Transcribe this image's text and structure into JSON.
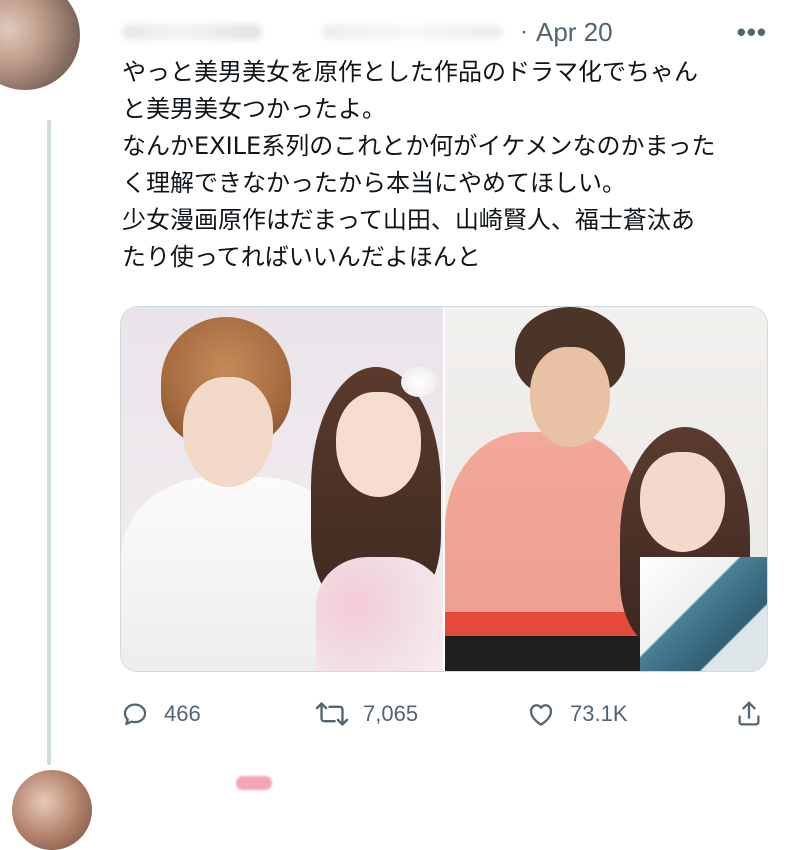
{
  "tweet": {
    "date": "Apr 20",
    "separator": "·",
    "more": "•••",
    "text": "やっと美男美女を原作とした作品のドラマ化でちゃん\nと美男美女つかったよ。\nなんかEXILE系列のこれとか何がイケメンなのかまった\nく理解できなかったから本当にやめてほしい。\n少女漫画原作はだまって山田、山崎賢人、福士蒼汰あ\nたり使ってればいいんだよほんと"
  },
  "actions": {
    "reply_count": "466",
    "retweet_count": "7,065",
    "like_count": "73.1K"
  },
  "icons": {
    "reply": "reply-icon",
    "retweet": "retweet-icon",
    "like": "heart-icon",
    "share": "share-icon",
    "more": "more-icon"
  },
  "colors": {
    "text": "#0f1419",
    "muted": "#536471",
    "border": "#cfd9de"
  }
}
